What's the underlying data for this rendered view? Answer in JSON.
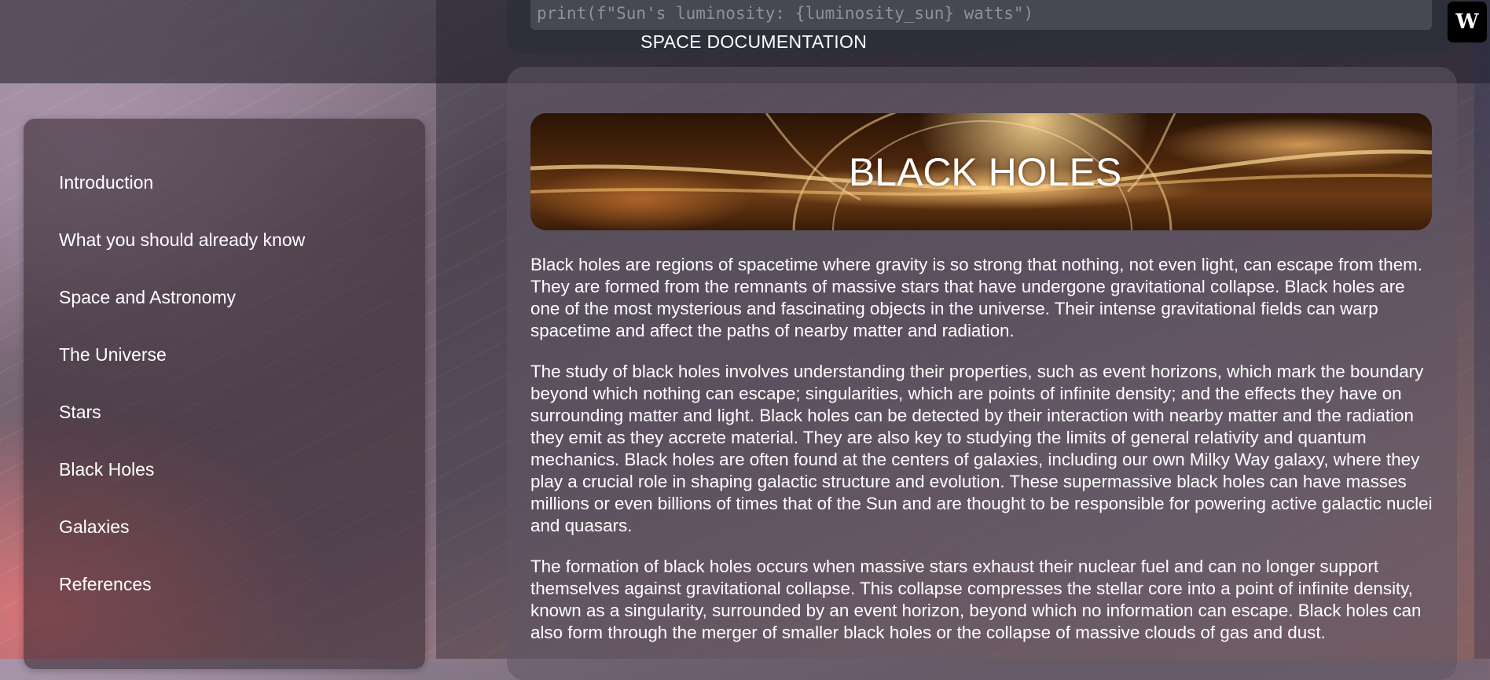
{
  "header": {
    "code_line": "print(f\"Sun's luminosity: {luminosity_sun} watts\")",
    "site_title": "SPACE DOCUMENTATION",
    "watermark_icon": "w-logo-icon"
  },
  "sidebar": {
    "items": [
      {
        "label": "Introduction"
      },
      {
        "label": "What you should already know"
      },
      {
        "label": "Space and Astronomy"
      },
      {
        "label": "The Universe"
      },
      {
        "label": "Stars"
      },
      {
        "label": "Black Holes"
      },
      {
        "label": "Galaxies"
      },
      {
        "label": "References"
      }
    ]
  },
  "main": {
    "banner_title": "BLACK HOLES",
    "paragraphs": [
      "Black holes are regions of spacetime where gravity is so strong that nothing, not even light, can escape from them. They are formed from the remnants of massive stars that have undergone gravitational collapse. Black holes are one of the most mysterious and fascinating objects in the universe. Their intense gravitational fields can warp spacetime and affect the paths of nearby matter and radiation.",
      "The study of black holes involves understanding their properties, such as event horizons, which mark the boundary beyond which nothing can escape; singularities, which are points of infinite density; and the effects they have on surrounding matter and light. Black holes can be detected by their interaction with nearby matter and the radiation they emit as they accrete material. They are also key to studying the limits of general relativity and quantum mechanics. Black holes are often found at the centers of galaxies, including our own Milky Way galaxy, where they play a crucial role in shaping galactic structure and evolution. These supermassive black holes can have masses millions or even billions of times that of the Sun and are thought to be responsible for powering active galactic nuclei and quasars.",
      "The formation of black holes occurs when massive stars exhaust their nuclear fuel and can no longer support themselves against gravitational collapse. This collapse compresses the stellar core into a point of infinite density, known as a singularity, surrounded by an event horizon, beyond which no information can escape. Black holes can also form through the merger of smaller black holes or the collapse of massive clouds of gas and dust."
    ]
  }
}
